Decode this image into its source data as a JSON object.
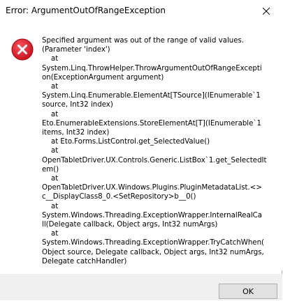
{
  "dialog": {
    "title": "Error: ArgumentOutOfRangeException",
    "close_icon": "close-icon",
    "error_icon": "error-circle-x-icon",
    "message_lines": [
      "Specified argument was out of the range of valid values.",
      "(Parameter 'index')",
      "    at",
      "System.Linq.ThrowHelper.ThrowArgumentOutOfRangeExcepti",
      "on(ExceptionArgument argument)",
      "    at",
      "System.Linq.Enumerable.ElementAt[TSource](IEnumerable`1",
      "source, Int32 index)",
      "    at",
      "Eto.EnumerableExtensions.StoreElementAt[T](IEnumerable`1",
      "items, Int32 index)",
      "    at Eto.Forms.ListControl.get_SelectedValue()",
      "    at",
      "OpenTabletDriver.UX.Controls.Generic.ListBox`1.get_SelectedIt",
      "em()",
      "    at",
      "OpenTabletDriver.UX.Windows.Plugins.PluginMetadataList.<>",
      "c__DisplayClass8_0.<SetRepository>b__0()",
      "    at",
      "System.Windows.Threading.ExceptionWrapper.InternalRealCa",
      "ll(Delegate callback, Object args, Int32 numArgs)",
      "    at",
      "System.Windows.Threading.ExceptionWrapper.TryCatchWhen(",
      "Object source, Delegate callback, Object args, Int32 numArgs,",
      "Delegate catchHandler)"
    ],
    "ok_label": "OK",
    "colors": {
      "error_red": "#e81123",
      "footer_bg": "#f0f0f0",
      "button_bg": "#e1e1e1"
    }
  }
}
